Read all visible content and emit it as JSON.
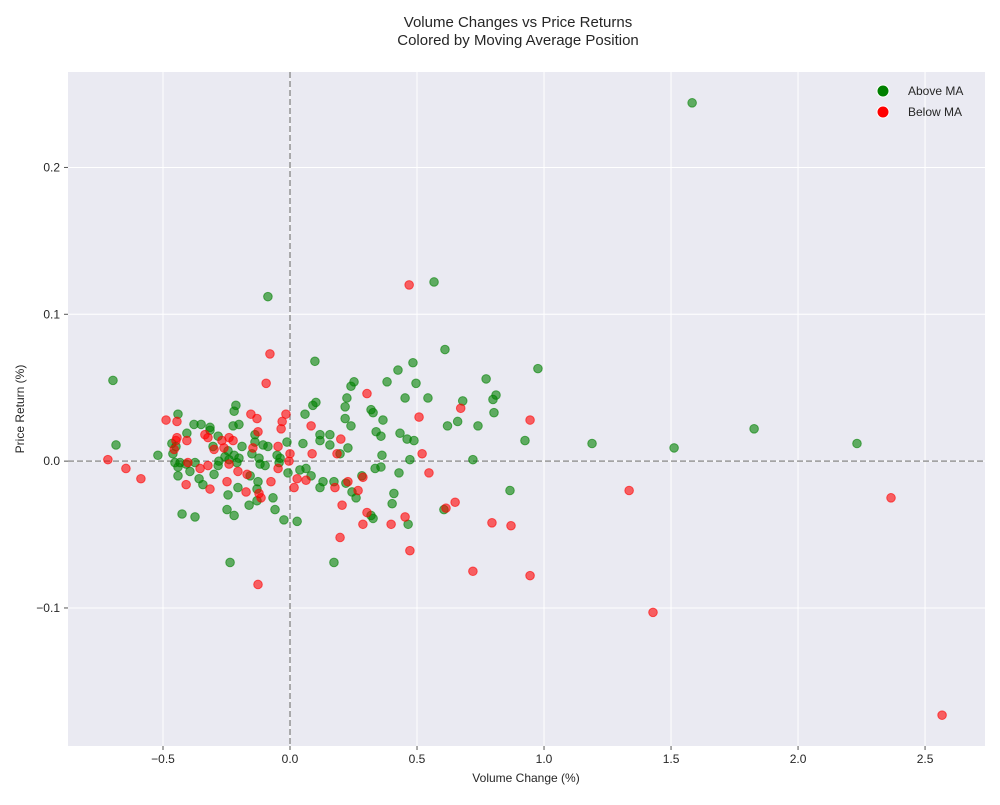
{
  "chart_data": {
    "type": "scatter",
    "title": "Volume Changes vs Price Returns",
    "subtitle": "Colored by Moving Average Position",
    "xlabel": "Volume Change (%)",
    "ylabel": "Price Return (%)",
    "xlim": [
      -0.874,
      2.736
    ],
    "ylim": [
      -0.194,
      0.265
    ],
    "xticks": [
      -0.5,
      0.0,
      0.5,
      1.0,
      1.5,
      2.0,
      2.5
    ],
    "xtick_labels": [
      "−0.5",
      "0.0",
      "0.5",
      "1.0",
      "1.5",
      "2.0",
      "2.5"
    ],
    "yticks": [
      -0.1,
      0.0,
      0.1,
      0.2
    ],
    "ytick_labels": [
      "−0.1",
      "0.0",
      "0.1",
      "0.2"
    ],
    "grid": true,
    "reference_lines": {
      "x": 0,
      "y": 0,
      "style": "dashed",
      "color": "#999999"
    },
    "legend_placement": "top-right",
    "background": "#eaeaf2",
    "series": [
      {
        "name": "Above MA",
        "color": "#008000",
        "points": [
          [
            1.583,
            0.244
          ],
          [
            -0.087,
            0.112
          ],
          [
            0.567,
            0.122
          ],
          [
            -0.697,
            0.055
          ],
          [
            -0.685,
            0.011
          ],
          [
            -0.52,
            0.004
          ],
          [
            0.61,
            0.076
          ],
          [
            0.976,
            0.063
          ],
          [
            0.484,
            0.067
          ],
          [
            0.772,
            0.056
          ],
          [
            0.811,
            0.045
          ],
          [
            0.799,
            0.042
          ],
          [
            0.803,
            0.033
          ],
          [
            0.925,
            0.014
          ],
          [
            1.189,
            0.012
          ],
          [
            1.512,
            0.009
          ],
          [
            1.827,
            0.022
          ],
          [
            2.232,
            0.012
          ],
          [
            0.866,
            -0.02
          ],
          [
            0.465,
            -0.043
          ],
          [
            0.606,
            -0.033
          ],
          [
            0.173,
            -0.069
          ],
          [
            -0.236,
            -0.069
          ],
          [
            -0.425,
            -0.036
          ],
          [
            -0.374,
            -0.038
          ],
          [
            0.327,
            -0.039
          ],
          [
            -0.024,
            -0.04
          ],
          [
            0.028,
            -0.041
          ],
          [
            0.098,
            0.068
          ],
          [
            0.543,
            0.043
          ],
          [
            0.382,
            0.054
          ],
          [
            0.252,
            0.054
          ],
          [
            0.24,
            0.051
          ],
          [
            0.224,
            0.043
          ],
          [
            0.425,
            0.062
          ],
          [
            0.496,
            0.053
          ],
          [
            0.453,
            0.043
          ],
          [
            0.059,
            0.032
          ],
          [
            0.09,
            0.038
          ],
          [
            0.102,
            0.04
          ],
          [
            0.217,
            0.029
          ],
          [
            0.24,
            0.024
          ],
          [
            0.157,
            0.018
          ],
          [
            0.118,
            0.018
          ],
          [
            0.118,
            0.014
          ],
          [
            0.217,
            0.037
          ],
          [
            0.319,
            0.035
          ],
          [
            0.327,
            0.033
          ],
          [
            0.366,
            0.028
          ],
          [
            0.339,
            0.02
          ],
          [
            0.358,
            0.017
          ],
          [
            0.433,
            0.019
          ],
          [
            0.461,
            0.015
          ],
          [
            0.488,
            0.014
          ],
          [
            0.362,
            0.004
          ],
          [
            0.472,
            0.001
          ],
          [
            0.358,
            -0.004
          ],
          [
            0.335,
            -0.005
          ],
          [
            0.429,
            -0.008
          ],
          [
            0.157,
            0.011
          ],
          [
            0.197,
            0.005
          ],
          [
            0.228,
            0.009
          ],
          [
            0.051,
            0.012
          ],
          [
            0.083,
            -0.01
          ],
          [
            0.063,
            -0.005
          ],
          [
            0.039,
            -0.006
          ],
          [
            0.13,
            -0.014
          ],
          [
            0.118,
            -0.018
          ],
          [
            0.173,
            -0.014
          ],
          [
            0.22,
            -0.015
          ],
          [
            0.244,
            -0.021
          ],
          [
            0.26,
            -0.025
          ],
          [
            0.283,
            -0.01
          ],
          [
            0.409,
            -0.022
          ],
          [
            0.402,
            -0.029
          ],
          [
            0.319,
            -0.037
          ],
          [
            0.72,
            0.001
          ],
          [
            0.66,
            0.027
          ],
          [
            0.62,
            0.024
          ],
          [
            0.68,
            0.041
          ],
          [
            0.74,
            0.024
          ],
          [
            -0.157,
            -0.01
          ],
          [
            -0.012,
            0.013
          ],
          [
            -0.043,
            -0.001
          ],
          [
            -0.067,
            -0.025
          ],
          [
            -0.059,
            -0.033
          ],
          [
            -0.051,
            0.004
          ],
          [
            -0.039,
            0.002
          ],
          [
            -0.106,
            0.011
          ],
          [
            -0.087,
            0.01
          ],
          [
            -0.098,
            -0.003
          ],
          [
            -0.008,
            -0.008
          ],
          [
            -0.138,
            0.013
          ],
          [
            -0.15,
            0.005
          ],
          [
            -0.189,
            0.01
          ],
          [
            -0.138,
            0.018
          ],
          [
            -0.122,
            0.002
          ],
          [
            -0.118,
            -0.002
          ],
          [
            -0.126,
            -0.014
          ],
          [
            -0.13,
            -0.019
          ],
          [
            -0.13,
            -0.027
          ],
          [
            -0.205,
            -0.018
          ],
          [
            -0.161,
            -0.03
          ],
          [
            -0.244,
            -0.023
          ],
          [
            -0.248,
            -0.033
          ],
          [
            -0.22,
            -0.037
          ],
          [
            -0.24,
            0.001
          ],
          [
            -0.22,
            0.004
          ],
          [
            -0.201,
            0.002
          ],
          [
            -0.209,
            -0.001
          ],
          [
            -0.244,
            0.007
          ],
          [
            -0.224,
            0.024
          ],
          [
            -0.201,
            0.025
          ],
          [
            -0.213,
            0.038
          ],
          [
            -0.22,
            0.034
          ],
          [
            -0.283,
            0.017
          ],
          [
            -0.256,
            0.003
          ],
          [
            -0.28,
            0.0
          ],
          [
            -0.315,
            0.021
          ],
          [
            -0.315,
            0.023
          ],
          [
            -0.35,
            0.025
          ],
          [
            -0.378,
            0.025
          ],
          [
            -0.303,
            0.01
          ],
          [
            -0.299,
            -0.009
          ],
          [
            -0.283,
            -0.003
          ],
          [
            -0.343,
            -0.016
          ],
          [
            -0.358,
            -0.012
          ],
          [
            -0.374,
            -0.001
          ],
          [
            -0.394,
            -0.007
          ],
          [
            -0.409,
            -0.002
          ],
          [
            -0.406,
            0.019
          ],
          [
            -0.441,
            0.032
          ],
          [
            -0.449,
            0.01
          ],
          [
            -0.461,
            0.005
          ],
          [
            -0.465,
            0.012
          ],
          [
            -0.441,
            -0.01
          ],
          [
            -0.441,
            -0.004
          ],
          [
            -0.453,
            -0.001
          ],
          [
            -0.433,
            -0.001
          ]
        ]
      },
      {
        "name": "Below MA",
        "color": "#ff0000",
        "points": [
          [
            0.469,
            0.12
          ],
          [
            -0.717,
            0.001
          ],
          [
            -0.646,
            -0.005
          ],
          [
            -0.587,
            -0.012
          ],
          [
            0.945,
            0.028
          ],
          [
            2.366,
            -0.025
          ],
          [
            2.567,
            -0.173
          ],
          [
            1.429,
            -0.103
          ],
          [
            1.335,
            -0.02
          ],
          [
            0.87,
            -0.044
          ],
          [
            0.795,
            -0.042
          ],
          [
            0.945,
            -0.078
          ],
          [
            0.72,
            -0.075
          ],
          [
            0.472,
            -0.061
          ],
          [
            0.453,
            -0.038
          ],
          [
            0.614,
            -0.032
          ],
          [
            0.65,
            -0.028
          ],
          [
            -0.126,
            -0.084
          ],
          [
            0.197,
            -0.052
          ],
          [
            0.287,
            -0.043
          ],
          [
            0.398,
            -0.043
          ],
          [
            -0.079,
            0.073
          ],
          [
            -0.094,
            0.053
          ],
          [
            0.52,
            0.005
          ],
          [
            0.547,
            -0.008
          ],
          [
            0.303,
            0.046
          ],
          [
            0.508,
            0.03
          ],
          [
            0.672,
            0.036
          ],
          [
            0.185,
            0.005
          ],
          [
            0.087,
            0.005
          ],
          [
            0.063,
            -0.013
          ],
          [
            0.028,
            -0.012
          ],
          [
            0.177,
            -0.018
          ],
          [
            0.228,
            -0.014
          ],
          [
            0.268,
            -0.02
          ],
          [
            0.287,
            -0.011
          ],
          [
            0.205,
            -0.03
          ],
          [
            0.303,
            -0.035
          ],
          [
            0.083,
            0.024
          ],
          [
            0.2,
            0.015
          ],
          [
            -0.031,
            0.027
          ],
          [
            -0.035,
            0.022
          ],
          [
            -0.016,
            0.032
          ],
          [
            0.0,
            0.005
          ],
          [
            -0.004,
            0.0
          ],
          [
            -0.047,
            -0.005
          ],
          [
            -0.075,
            -0.014
          ],
          [
            -0.047,
            0.01
          ],
          [
            0.016,
            -0.018
          ],
          [
            -0.146,
            0.009
          ],
          [
            -0.154,
            0.032
          ],
          [
            -0.13,
            0.029
          ],
          [
            -0.126,
            0.02
          ],
          [
            -0.122,
            -0.022
          ],
          [
            -0.114,
            -0.025
          ],
          [
            -0.169,
            -0.009
          ],
          [
            -0.173,
            -0.021
          ],
          [
            -0.248,
            -0.014
          ],
          [
            -0.24,
            -0.002
          ],
          [
            -0.205,
            -0.007
          ],
          [
            -0.24,
            0.016
          ],
          [
            -0.224,
            0.014
          ],
          [
            -0.268,
            0.014
          ],
          [
            -0.26,
            0.009
          ],
          [
            -0.335,
            0.018
          ],
          [
            -0.323,
            0.016
          ],
          [
            -0.299,
            0.008
          ],
          [
            -0.315,
            -0.019
          ],
          [
            -0.323,
            -0.003
          ],
          [
            -0.354,
            -0.005
          ],
          [
            -0.409,
            -0.016
          ],
          [
            -0.402,
            -0.001
          ],
          [
            -0.406,
            0.014
          ],
          [
            -0.445,
            0.027
          ],
          [
            -0.445,
            0.016
          ],
          [
            -0.449,
            0.014
          ],
          [
            -0.488,
            0.028
          ],
          [
            -0.456,
            0.008
          ]
        ]
      }
    ]
  }
}
